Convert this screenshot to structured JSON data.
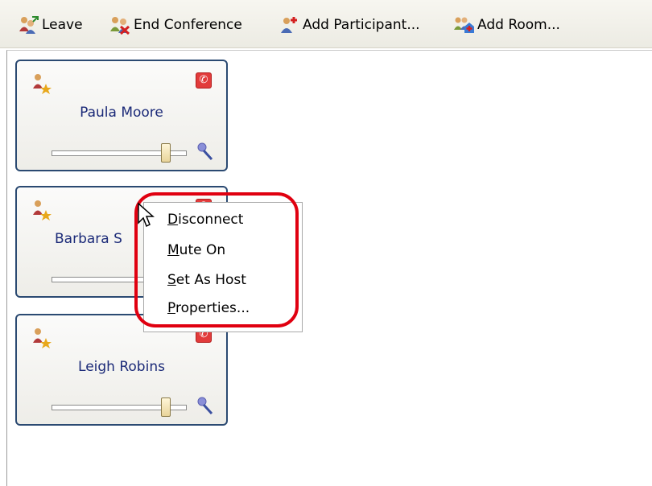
{
  "toolbar": {
    "leave": {
      "label": "Leave",
      "icon": "leave-icon"
    },
    "end_conference": {
      "label": "End Conference",
      "icon": "end-conference-icon"
    },
    "add_participant": {
      "label": "Add Participant...",
      "icon": "add-participant-icon"
    },
    "add_room": {
      "label": "Add Room...",
      "icon": "add-room-icon"
    }
  },
  "participants": [
    {
      "name": "Paula Moore",
      "volume": 0.85
    },
    {
      "name": "Barbara S",
      "volume": 0.85
    },
    {
      "name": "Leigh Robins",
      "volume": 0.85
    }
  ],
  "context_menu": {
    "items": [
      {
        "underline": "D",
        "rest": "isconnect"
      },
      {
        "underline": "M",
        "rest": "ute On"
      },
      {
        "underline": "S",
        "rest": "et As Host"
      },
      {
        "underline": "P",
        "rest": "roperties..."
      }
    ]
  },
  "colors": {
    "card_border": "#2b4a72",
    "name_text": "#1b2a78",
    "highlight": "#e00010",
    "phone_button": "#e23b3b"
  }
}
